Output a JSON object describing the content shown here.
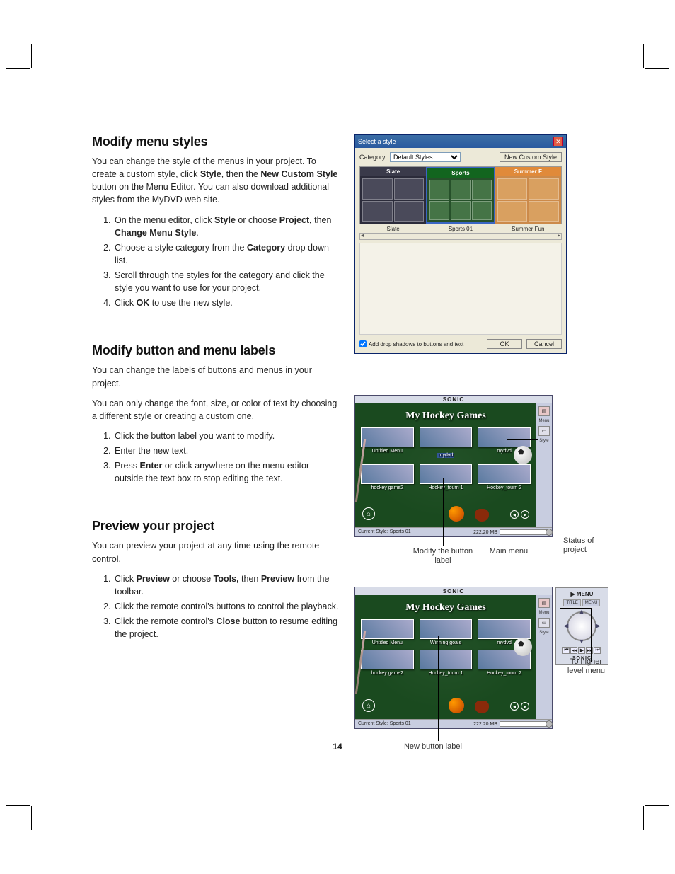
{
  "page_number": "14",
  "s1": {
    "heading": "Modify menu styles",
    "intro": "You can change the style of the menus in your project. To create a custom style, click ",
    "intro_b1": "Style",
    "intro_mid": ", then the ",
    "intro_b2": "New Custom Style",
    "intro_end": " button on the Menu Editor. You can also download additional styles from the MyDVD web site.",
    "li1a": "On the menu editor, click ",
    "li1b": "Style",
    "li1c": " or choose ",
    "li1d": "Project,",
    "li1e": " then ",
    "li1f": "Change Menu Style",
    "li1g": ".",
    "li2a": "Choose a style category from the ",
    "li2b": "Category",
    "li2c": " drop down list.",
    "li3": "Scroll through the styles for the category and click the style you want to use for your project.",
    "li4a": "Click ",
    "li4b": "OK",
    "li4c": " to use the new style."
  },
  "s2": {
    "heading": "Modify button and menu labels",
    "p1": "You can change the labels of buttons and menus in your project.",
    "p2": "You can only change the font, size, or color of text by choosing a different style or creating a custom one.",
    "li1": "Click the button label you want to modify.",
    "li2": "Enter the new text.",
    "li3a": "Press ",
    "li3b": "Enter",
    "li3c": " or click anywhere on the menu editor outside the text box to stop editing the text."
  },
  "s3": {
    "heading": "Preview your project",
    "p1": "You can preview your project at any time using the remote control.",
    "li1a": "Click ",
    "li1b": "Preview",
    "li1c": " or choose ",
    "li1d": "Tools,",
    "li1e": " then ",
    "li1f": "Preview",
    "li1g": " from the toolbar.",
    "li2": "Click the remote control's buttons to control the playback.",
    "li3a": "Click the remote control's ",
    "li3b": "Close",
    "li3c": " button to resume editing the project."
  },
  "dlg": {
    "title": "Select a style",
    "category_label": "Category:",
    "category_value": "Default Styles",
    "new_custom": "New Custom Style",
    "styles": {
      "slate": "Slate",
      "sports": "Sports",
      "summer": "Summer F"
    },
    "labels": {
      "slate": "Slate",
      "sports": "Sports 01",
      "summer": "Summer Fun"
    },
    "checkbox": "Add drop shadows to buttons and text",
    "ok": "OK",
    "cancel": "Cancel"
  },
  "dvd": {
    "brand": "SONIC",
    "title": "My Hockey Games",
    "thumbs_a": [
      "Untitled Menu",
      "mydvd",
      "mydvd",
      "hockey game2",
      "Hockey_tourn 1",
      "Hockey_tourn 2"
    ],
    "thumbs_b": [
      "Untitled Menu",
      "Winning goals",
      "mydvd",
      "hockey game2",
      "Hockey_tourn 1",
      "Hockey_tourn 2"
    ],
    "side_menu": "Menu",
    "side_style": "Style",
    "status_style": "Current Style: Sports 01",
    "status_size": "222.20 MB",
    "remote": {
      "menu": "▶ MENU",
      "tab1": "TITLE",
      "tab2": "MENU",
      "brand": "SONIC"
    }
  },
  "callouts": {
    "modify": "Modify the button label",
    "main": "Main menu",
    "status": "Status of project",
    "higher": "To higher level menu",
    "newlabel": "New button label"
  }
}
